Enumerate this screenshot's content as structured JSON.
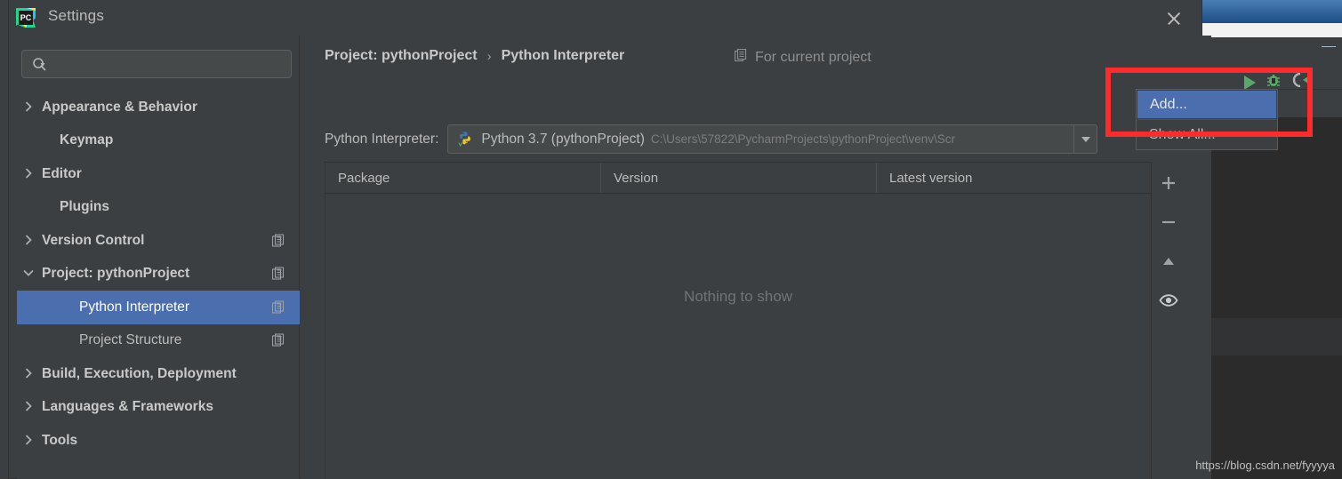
{
  "window": {
    "title": "Settings",
    "logo_icon": "pycharm-logo-icon",
    "close_icon": "close-icon"
  },
  "search": {
    "value": "",
    "placeholder": "",
    "icon": "search-icon"
  },
  "sidebar": {
    "items": [
      {
        "label": "Appearance & Behavior",
        "chevron": "chevron-right-icon",
        "indent": 28,
        "bold": true,
        "selected": false,
        "copy": false
      },
      {
        "label": "Keymap",
        "chevron": "",
        "indent": 48,
        "bold": true,
        "selected": false,
        "copy": false
      },
      {
        "label": "Editor",
        "chevron": "chevron-right-icon",
        "indent": 28,
        "bold": true,
        "selected": false,
        "copy": false
      },
      {
        "label": "Plugins",
        "chevron": "",
        "indent": 48,
        "bold": true,
        "selected": false,
        "copy": false
      },
      {
        "label": "Version Control",
        "chevron": "chevron-right-icon",
        "indent": 28,
        "bold": true,
        "selected": false,
        "copy": true
      },
      {
        "label": "Project: pythonProject",
        "chevron": "chevron-down-icon",
        "indent": 28,
        "bold": true,
        "selected": false,
        "copy": true
      },
      {
        "label": "Python Interpreter",
        "chevron": "",
        "indent": 70,
        "bold": false,
        "selected": true,
        "copy": true
      },
      {
        "label": "Project Structure",
        "chevron": "",
        "indent": 70,
        "bold": false,
        "selected": false,
        "copy": true
      },
      {
        "label": "Build, Execution, Deployment",
        "chevron": "chevron-right-icon",
        "indent": 28,
        "bold": true,
        "selected": false,
        "copy": false
      },
      {
        "label": "Languages & Frameworks",
        "chevron": "chevron-right-icon",
        "indent": 28,
        "bold": true,
        "selected": false,
        "copy": false
      },
      {
        "label": "Tools",
        "chevron": "chevron-right-icon",
        "indent": 28,
        "bold": true,
        "selected": false,
        "copy": false
      }
    ]
  },
  "content": {
    "breadcrumb": {
      "root": "Project: pythonProject",
      "separator": "›",
      "leaf": "Python Interpreter"
    },
    "scope": {
      "icon": "module-copy-icon",
      "label": "For current project"
    },
    "interpreter": {
      "label": "Python Interpreter:",
      "icon": "python-icon",
      "name": "Python 3.7 (pythonProject)",
      "path": "C:\\Users\\57822\\PycharmProjects\\pythonProject\\venv\\Scr",
      "arrow_icon": "chevron-down-icon"
    },
    "packages_table": {
      "columns": [
        "Package",
        "Version",
        "Latest version"
      ],
      "rows": [],
      "empty_text": "Nothing to show"
    },
    "table_toolbar": [
      {
        "icon": "plus-icon",
        "name": "install-package-button"
      },
      {
        "icon": "minus-icon",
        "name": "uninstall-package-button"
      },
      {
        "icon": "arrow-up-icon",
        "name": "upgrade-package-button"
      },
      {
        "icon": "eye-icon",
        "name": "show-early-releases-button"
      }
    ]
  },
  "dropdown": {
    "items": [
      {
        "label": "Add...",
        "highlighted": true
      },
      {
        "label": "Show All...",
        "highlighted": false
      }
    ]
  },
  "ide_background": {
    "run_icon": "run-triangle-icon",
    "debug_icon": "debug-bug-icon",
    "coverage_icon": "run-with-coverage-icon",
    "minimize_icon": "minimize-icon"
  },
  "annotation": {
    "color": "#fd2b2b"
  },
  "watermark": {
    "text": "https://blog.csdn.net/fyyyya"
  }
}
